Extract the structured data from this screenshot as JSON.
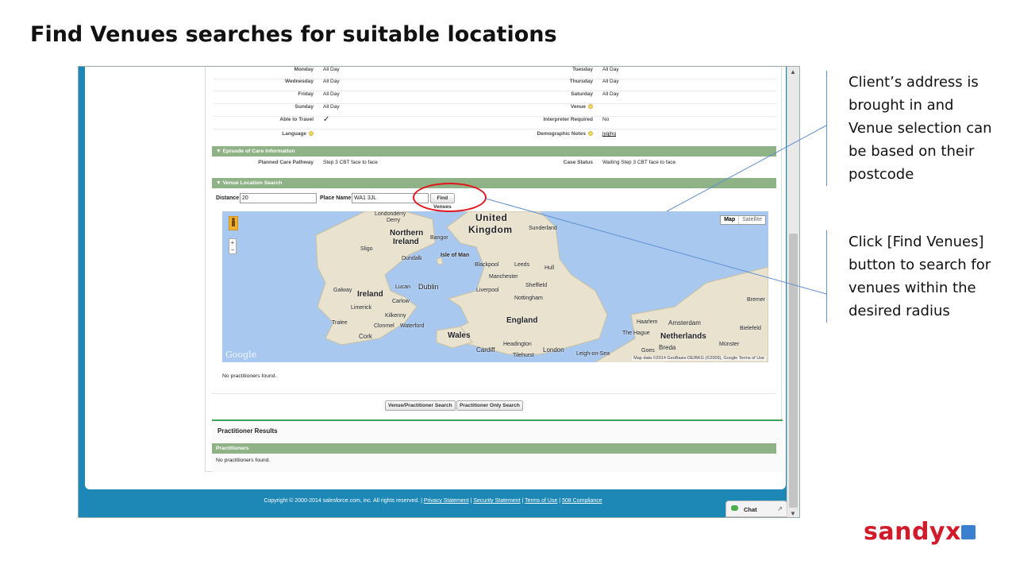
{
  "slide": {
    "title": "Find Venues searches for suitable locations",
    "callouts": [
      "Client’s address is brought in and Venue selection can be based on their postcode",
      "Click [Find Venues] button to search for venues within the desired radius"
    ],
    "logo_text": "sandyx"
  },
  "details": {
    "rows": [
      {
        "left_label": "Monday",
        "left_value": "All Day",
        "right_label": "Tuesday",
        "right_value": "All Day"
      },
      {
        "left_label": "Wednesday",
        "left_value": "All Day",
        "right_label": "Thursday",
        "right_value": "All Day"
      },
      {
        "left_label": "Friday",
        "left_value": "All Day",
        "right_label": "Saturday",
        "right_value": "All Day"
      },
      {
        "left_label": "Sunday",
        "left_value": "All Day",
        "right_label": "Venue",
        "right_value": ""
      },
      {
        "left_label": "Able to Travel",
        "left_value": "✓",
        "right_label": "Interpreter Required",
        "right_value": "No"
      },
      {
        "left_label": "Language",
        "left_value": "",
        "right_label": "Demographic Notes",
        "right_value": "jygjhg"
      }
    ]
  },
  "episode": {
    "header": "Episode of Care Information",
    "planned_label": "Planned Care Pathway",
    "planned_value": "Step 3 CBT face to face",
    "status_label": "Case Status",
    "status_value": "Waiting Step 3 CBT face to face"
  },
  "venue_search": {
    "header": "Venue Location Search",
    "distance_label": "Distance",
    "distance_value": "20",
    "place_label": "Place Name",
    "place_value": "WA1 3JL",
    "find_button": "Find Venues"
  },
  "map": {
    "type_map": "Map",
    "type_satellite": "Satellite",
    "zoom_in": "+",
    "zoom_out": "−",
    "google": "Google",
    "attribution": "Map data ©2014 GeoBasis-DE/BKG (©2009), Google  Terms of Use",
    "labels": {
      "londonderry": "Londonderry",
      "derry": "Derry",
      "northern": "Northern",
      "ireland_ni": "Ireland",
      "bangor": "Bangor",
      "united": "United",
      "kingdom": "Kingdom",
      "sunderland": "Sunderland",
      "sligo": "Sligo",
      "dundalk": "Dundalk",
      "isle_of_man": "Isle of Man",
      "blackpool": "Blackpool",
      "leeds": "Leeds",
      "hull": "Hull",
      "manchester": "Manchester",
      "sheffield": "Sheffield",
      "liverpool": "Liverpool",
      "nottingham": "Nottingham",
      "galway": "Galway",
      "ireland": "Ireland",
      "lucan": "Lucan",
      "dublin": "Dublin",
      "limerick": "Limerick",
      "carlow": "Carlow",
      "kilkenny": "Kilkenny",
      "tralee": "Tralee",
      "clonmel": "Clonmel",
      "waterford": "Waterford",
      "cork": "Cork",
      "england": "England",
      "wales": "Wales",
      "cardiff": "Cardiff",
      "headington": "Headington",
      "london": "London",
      "tilehurst": "Tilehurst",
      "leigh_on_sea": "Leigh-on-Sea",
      "haarlem": "Haarlem",
      "amsterdam": "Amsterdam",
      "the_hague": "The Hague",
      "netherlands": "Netherlands",
      "bielefeld": "Bielefeld",
      "munster": "Münster",
      "breda": "Breda",
      "goes": "Goes",
      "bremen": "Bremer"
    }
  },
  "venue_results_text": "No practitioners found.",
  "buttons": {
    "venue_practitioner_search": "Venue/Practitioner Search",
    "practitioner_only_search": "Practitioner Only Search"
  },
  "practitioner_results": {
    "title": "Practitioner Results",
    "header": "Practitioners",
    "empty_text": "No practitioners found."
  },
  "footer": {
    "copyright": "Copyright © 2000-2014 salesforce.com, inc. All rights reserved. | ",
    "privacy": "Privacy Statement",
    "sep": " | ",
    "security": "Security Statement",
    "terms": "Terms of Use",
    "compliance": "508 Compliance"
  },
  "chat": {
    "label": "Chat"
  },
  "colors": {
    "section_bar": "#8fb386",
    "footer_blue": "#1d87b6",
    "highlight_red": "#e3141b",
    "callout_line": "#5f8fd0",
    "logo_red": "#d11a2a"
  }
}
